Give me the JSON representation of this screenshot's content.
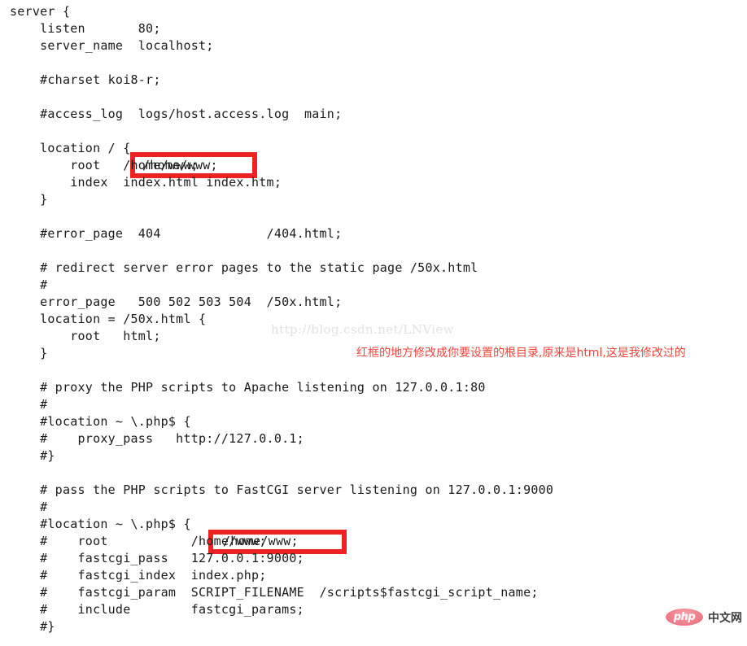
{
  "document": {
    "type": "nginx-configuration-file",
    "code_lines": [
      "server {",
      "    listen       80;",
      "    server_name  localhost;",
      "",
      "    #charset koi8-r;",
      "",
      "    #access_log  logs/host.access.log  main;",
      "",
      "    location / {",
      "        root   /home/www;",
      "        index  index.html index.htm;",
      "    }",
      "",
      "    #error_page  404              /404.html;",
      "",
      "    # redirect server error pages to the static page /50x.html",
      "    #",
      "    error_page   500 502 503 504  /50x.html;",
      "    location = /50x.html {",
      "        root   html;",
      "    }",
      "",
      "    # proxy the PHP scripts to Apache listening on 127.0.0.1:80",
      "    #",
      "    #location ~ \\.php$ {",
      "    #    proxy_pass   http://127.0.0.1;",
      "    #}",
      "",
      "    # pass the PHP scripts to FastCGI server listening on 127.0.0.1:9000",
      "    #",
      "    #location ~ \\.php$ {",
      "    #    root           /home/www;",
      "    #    fastcgi_pass   127.0.0.1:9000;",
      "    #    fastcgi_index  index.php;",
      "    #    fastcgi_param  SCRIPT_FILENAME  /scripts$fastcgi_script_name;",
      "    #    include        fastcgi_params;",
      "    #}"
    ]
  },
  "highlights": {
    "box_color": "#ee2222",
    "box_1": {
      "label": "location-root-directive-highlight",
      "value": "/home/www;"
    },
    "box_2": {
      "label": "fastcgi-root-directive-highlight",
      "value": "/home/www;"
    }
  },
  "annotation": {
    "text": "红框的地方修改成你要设置的根目录,原来是html,这是我修改过的",
    "color": "#f0453c"
  },
  "watermark": {
    "url": "http://blog.csdn.net/LNView",
    "color": "#e2e2e2"
  },
  "php_logo": {
    "badge_text": "php",
    "site_text": "中文网",
    "badge_color": "#ef7f8d"
  }
}
